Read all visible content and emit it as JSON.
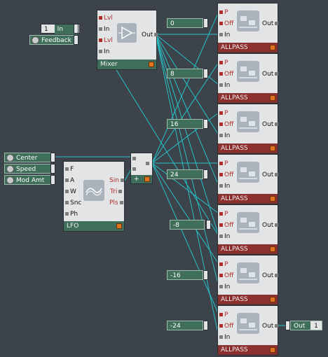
{
  "mixer": {
    "title": "Mixer",
    "ports_in": [
      "Lvl",
      "In",
      "Lvl",
      "In"
    ],
    "port_out": "Out"
  },
  "in_source": {
    "value": "1",
    "label": "In"
  },
  "feedback": {
    "label": "Feedback"
  },
  "lfo": {
    "title": "LFO",
    "ports_in": [
      "F",
      "A",
      "W",
      "Snc",
      "Ph"
    ],
    "ports_out": [
      "Sin",
      "Tri",
      "Pls"
    ]
  },
  "macros": {
    "center": "Center",
    "speed": "Speed",
    "mod_amt": "Mod Amt"
  },
  "adder": {
    "label": "+"
  },
  "allpass": {
    "title": "ALLPASS",
    "ports": [
      "P",
      "Off",
      "In"
    ],
    "out": "Out",
    "offsets": [
      "0",
      "8",
      "16",
      "24",
      "-8",
      "-16",
      "-24"
    ]
  },
  "output": {
    "label": "Out",
    "value": "1"
  },
  "colors": {
    "wire": "#27c2c8",
    "panel": "#e3e4e5",
    "allpass_title": "#8c2f2f",
    "green_title": "#3f6e5b",
    "led": "#e0741e"
  }
}
